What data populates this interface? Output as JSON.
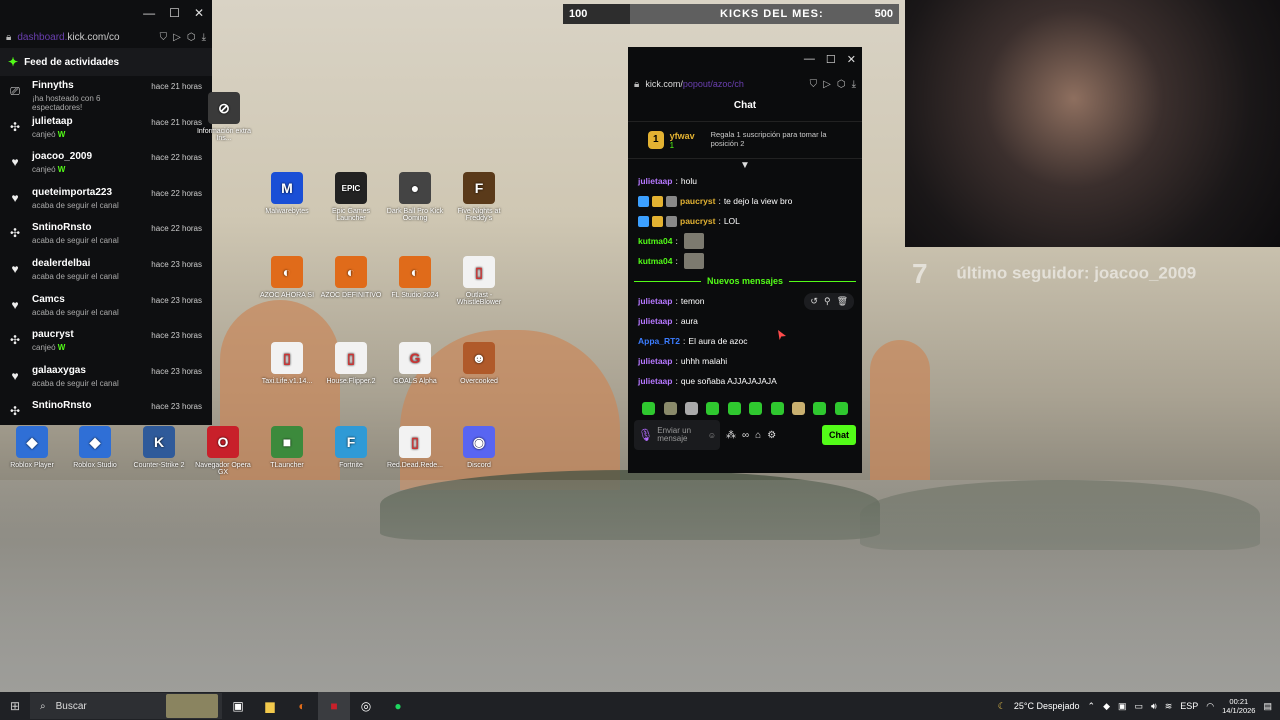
{
  "activity_panel": {
    "url_prefix": "dashboard.",
    "url": "kick.com/co",
    "feed_title": "Feed de actividades",
    "items": [
      {
        "icon": "host-icon",
        "glyph": "⎚",
        "name": "Finnyths",
        "desc": "¡ha hosteado con 6 espectadores!",
        "time": "hace 21 horas"
      },
      {
        "icon": "redeem-icon",
        "glyph": "✣",
        "name": "julietaap",
        "desc": "canjeó W",
        "time": "hace 21 horas"
      },
      {
        "icon": "heart-icon",
        "glyph": "♥",
        "name": "joacoo_2009",
        "desc": "canjeó W",
        "time": "hace 22 horas"
      },
      {
        "icon": "heart-icon",
        "glyph": "♥",
        "name": "queteimporta223",
        "desc": "acaba de seguir el canal",
        "time": "hace 22 horas"
      },
      {
        "icon": "redeem-icon",
        "glyph": "✣",
        "name": "SntinoRnsto",
        "desc": "acaba de seguir el canal",
        "time": "hace 22 horas"
      },
      {
        "icon": "heart-icon",
        "glyph": "♥",
        "name": "dealerdelbai",
        "desc": "acaba de seguir el canal",
        "time": "hace 23 horas"
      },
      {
        "icon": "heart-icon",
        "glyph": "♥",
        "name": "Camcs",
        "desc": "acaba de seguir el canal",
        "time": "hace 23 horas"
      },
      {
        "icon": "redeem-icon",
        "glyph": "✣",
        "name": "paucryst",
        "desc": "canjeó W",
        "time": "hace 23 horas"
      },
      {
        "icon": "heart-icon",
        "glyph": "♥",
        "name": "galaaxygas",
        "desc": "acaba de seguir el canal",
        "time": "hace 23 horas"
      },
      {
        "icon": "redeem-icon",
        "glyph": "✣",
        "name": "SntinoRnsto",
        "desc": "",
        "time": "hace 23 horas"
      }
    ]
  },
  "desktop_icons": [
    {
      "label": "Información extra Ins...",
      "color": "#3a3a3a",
      "glyph": "⊘"
    },
    {
      "label": "Malwarebytes",
      "color": "#1a4fd6",
      "glyph": "M"
    },
    {
      "label": "Epic Games Launcher",
      "color": "#222222",
      "glyph": "EPIC"
    },
    {
      "label": "Dark Ball Pro Kick Ooming",
      "color": "#444444",
      "glyph": "●"
    },
    {
      "label": "Five Nights at Freddy's",
      "color": "#5a3a1a",
      "glyph": "F"
    },
    {
      "label": "AZOC AHORA SI",
      "color": "#e06b1a",
      "glyph": "◐"
    },
    {
      "label": "AZOC DEFINITIVO",
      "color": "#e06b1a",
      "glyph": "◐"
    },
    {
      "label": "FL Studio 2024",
      "color": "#e06b1a",
      "glyph": "◐"
    },
    {
      "label": "Outlast - WhistleBlower",
      "color": "#f2f2f2",
      "glyph": "▯"
    },
    {
      "label": "Taxi.Life.v1.14...",
      "color": "#f2f2f2",
      "glyph": "▯"
    },
    {
      "label": "House.Flipper.2",
      "color": "#f2f2f2",
      "glyph": "▯"
    },
    {
      "label": "GOALS Alpha",
      "color": "#f2f2f2",
      "glyph": "G"
    },
    {
      "label": "Overcooked",
      "color": "#b05a2a",
      "glyph": "☻"
    },
    {
      "label": "Roblox Player",
      "color": "#2f6fd6",
      "glyph": "◆"
    },
    {
      "label": "Roblox Studio",
      "color": "#2f6fd6",
      "glyph": "◆"
    },
    {
      "label": "Counter-Strike 2",
      "color": "#2f5a9a",
      "glyph": "K"
    },
    {
      "label": "Navegador Opera GX",
      "color": "#c8202a",
      "glyph": "O"
    },
    {
      "label": "TLauncher",
      "color": "#3c8a3c",
      "glyph": "■"
    },
    {
      "label": "Fortnite",
      "color": "#2f9ad6",
      "glyph": "F"
    },
    {
      "label": "Red.Dead.Rede...",
      "color": "#f2f2f2",
      "glyph": "▯"
    },
    {
      "label": "Discord",
      "color": "#5865f2",
      "glyph": "◉"
    }
  ],
  "kicks_bar": {
    "current": "100",
    "label": "KICKS DEL MES:",
    "goal": "500",
    "progress": 0.2
  },
  "overlay": {
    "number": "7",
    "last_follower": "último seguidor: joacoo_2009"
  },
  "chat": {
    "url_prefix": "kick.com/",
    "url": "popout/azoc/ch",
    "title": "Chat",
    "top_sub": {
      "name": "yfwav",
      "count": "1",
      "message": "Regala 1 suscripción para tomar la posición 2"
    },
    "messages": [
      {
        "user": "julietaap",
        "color": "#b678ff",
        "text": "holu",
        "badges": []
      },
      {
        "user": "paucryst",
        "color": "#e3b232",
        "text": "te dejo la view bro",
        "badges": [
          "#3ca0ff",
          "#e3b232",
          "#888"
        ]
      },
      {
        "user": "paucryst",
        "color": "#e3b232",
        "text": "LOL",
        "badges": [
          "#3ca0ff",
          "#e3b232",
          "#888"
        ]
      },
      {
        "user": "kutma04",
        "color": "#53fc18",
        "text": "",
        "badges": [],
        "emote": true
      },
      {
        "user": "kutma04",
        "color": "#53fc18",
        "text": "",
        "badges": [],
        "emote": true
      }
    ],
    "new_messages_label": "Nuevos mensajes",
    "new_messages": [
      {
        "user": "julietaap",
        "color": "#b678ff",
        "text": "temon"
      },
      {
        "user": "julietaap",
        "color": "#b678ff",
        "text": "aura"
      },
      {
        "user": "Appa_RT2",
        "color": "#3c7dff",
        "text": "El aura de azoc"
      },
      {
        "user": "julietaap",
        "color": "#b678ff",
        "text": "uhhh malahi"
      },
      {
        "user": "julietaap",
        "color": "#b678ff",
        "text": "que soñaba AJJAJAJAJA"
      }
    ],
    "input_placeholder": "Enviar un mensaje",
    "send_label": "Chat"
  },
  "taskbar": {
    "search_placeholder": "Buscar",
    "weather": "25°C Despejado",
    "lang": "ESP",
    "time": "00:21",
    "date": "14/1/2026"
  }
}
